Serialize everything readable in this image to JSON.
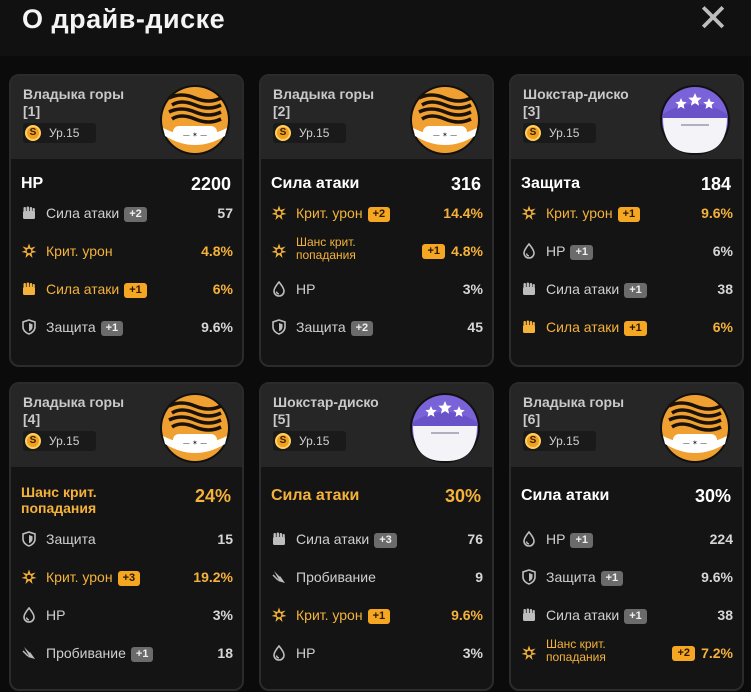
{
  "header": {
    "title": "О драйв-диске",
    "close_label": "✕"
  },
  "level_prefix": "Ур.",
  "colors": {
    "gold": "#f5b23a",
    "gray_text": "#cfcfcf",
    "badge_gray": "#6b6b6b",
    "badge_gold": "#f5a623"
  },
  "cards": [
    {
      "name": "Владыка горы",
      "slot": "[1]",
      "level": "Ур.15",
      "disc": "tiger",
      "main": {
        "label": "HP",
        "value": "2200",
        "gold": false
      },
      "subs": [
        {
          "icon": "fist-icon",
          "label": "Сила атаки",
          "badge": "+2",
          "value": "57",
          "gold": false
        },
        {
          "icon": "crit-icon",
          "label": "Крит. урон",
          "badge": "",
          "value": "4.8%",
          "gold": true
        },
        {
          "icon": "fist-icon",
          "label": "Сила атаки",
          "badge": "+1",
          "value": "6%",
          "gold": true
        },
        {
          "icon": "shield-icon",
          "label": "Защита",
          "badge": "+1",
          "value": "9.6%",
          "gold": false
        }
      ]
    },
    {
      "name": "Владыка горы",
      "slot": "[2]",
      "level": "Ур.15",
      "disc": "tiger",
      "main": {
        "label": "Сила атаки",
        "value": "316",
        "gold": false
      },
      "subs": [
        {
          "icon": "crit-icon",
          "label": "Крит. урон",
          "badge": "+2",
          "value": "14.4%",
          "gold": true
        },
        {
          "icon": "crit-icon",
          "label": "Шанс крит. попадания",
          "badge": "+1",
          "value": "4.8%",
          "gold": true,
          "two": true
        },
        {
          "icon": "drop-icon",
          "label": "HP",
          "badge": "",
          "value": "3%",
          "gold": false
        },
        {
          "icon": "shield-icon",
          "label": "Защита",
          "badge": "+2",
          "value": "45",
          "gold": false
        }
      ]
    },
    {
      "name": "Шокстар-диско",
      "slot": "[3]",
      "level": "Ур.15",
      "disc": "stars",
      "main": {
        "label": "Защита",
        "value": "184",
        "gold": false
      },
      "subs": [
        {
          "icon": "crit-icon",
          "label": "Крит. урон",
          "badge": "+1",
          "value": "9.6%",
          "gold": true
        },
        {
          "icon": "drop-icon",
          "label": "HP",
          "badge": "+1",
          "value": "6%",
          "gold": false
        },
        {
          "icon": "fist-icon",
          "label": "Сила атаки",
          "badge": "+1",
          "value": "38",
          "gold": false
        },
        {
          "icon": "fist-icon",
          "label": "Сила атаки",
          "badge": "+1",
          "value": "6%",
          "gold": true
        }
      ]
    },
    {
      "name": "Владыка горы",
      "slot": "[4]",
      "level": "Ур.15",
      "disc": "tiger",
      "main": {
        "label": "Шанс крит. попадания",
        "value": "24%",
        "gold": true,
        "two": true
      },
      "subs": [
        {
          "icon": "shield-icon",
          "label": "Защита",
          "badge": "",
          "value": "15",
          "gold": false
        },
        {
          "icon": "crit-icon",
          "label": "Крит. урон",
          "badge": "+3",
          "value": "19.2%",
          "gold": true
        },
        {
          "icon": "drop-icon",
          "label": "HP",
          "badge": "",
          "value": "3%",
          "gold": false
        },
        {
          "icon": "pierce-icon",
          "label": "Пробивание",
          "badge": "+1",
          "value": "18",
          "gold": false
        }
      ]
    },
    {
      "name": "Шокстар-диско",
      "slot": "[5]",
      "level": "Ур.15",
      "disc": "stars",
      "main": {
        "label": "Сила атаки",
        "value": "30%",
        "gold": true
      },
      "subs": [
        {
          "icon": "fist-icon",
          "label": "Сила атаки",
          "badge": "+3",
          "value": "76",
          "gold": false
        },
        {
          "icon": "pierce-icon",
          "label": "Пробивание",
          "badge": "",
          "value": "9",
          "gold": false
        },
        {
          "icon": "crit-icon",
          "label": "Крит. урон",
          "badge": "+1",
          "value": "9.6%",
          "gold": true
        },
        {
          "icon": "drop-icon",
          "label": "HP",
          "badge": "",
          "value": "3%",
          "gold": false
        }
      ]
    },
    {
      "name": "Владыка горы",
      "slot": "[6]",
      "level": "Ур.15",
      "disc": "tiger",
      "main": {
        "label": "Сила атаки",
        "value": "30%",
        "gold": false
      },
      "subs": [
        {
          "icon": "drop-icon",
          "label": "HP",
          "badge": "+1",
          "value": "224",
          "gold": false
        },
        {
          "icon": "shield-icon",
          "label": "Защита",
          "badge": "+1",
          "value": "9.6%",
          "gold": false
        },
        {
          "icon": "fist-icon",
          "label": "Сила атаки",
          "badge": "+1",
          "value": "38",
          "gold": false
        },
        {
          "icon": "crit-icon",
          "label": "Шанс крит. попадания",
          "badge": "+2",
          "value": "7.2%",
          "gold": true,
          "two": true
        }
      ]
    }
  ]
}
